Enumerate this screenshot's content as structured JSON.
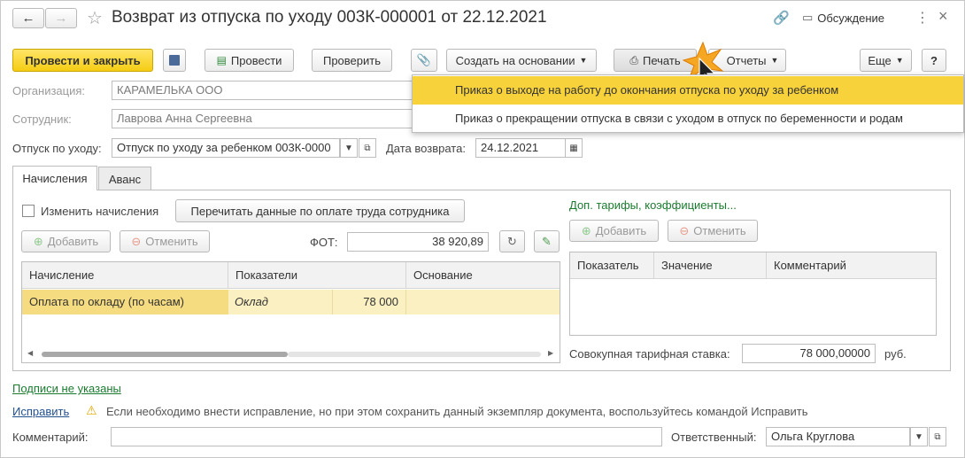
{
  "window": {
    "title": "Возврат из отпуска по уходу 003К-000001 от 22.12.2021",
    "discussion_label": "Обсуждение"
  },
  "toolbar": {
    "post_close": "Провести и закрыть",
    "post": "Провести",
    "check": "Проверить",
    "create_based": "Создать на основании",
    "print": "Печать",
    "reports": "Отчеты",
    "more": "Еще",
    "help": "?"
  },
  "print_menu": {
    "items": [
      "Приказ о выходе на работу до окончания отпуска по уходу за ребенком",
      "Приказ о прекращении отпуска в связи с уходом в отпуск по беременности и родам"
    ]
  },
  "form": {
    "org_label": "Организация:",
    "org_value": "КАРАМЕЛЬКА ООО",
    "emp_label": "Сотрудник:",
    "emp_value": "Лаврова Анна Сергеевна",
    "leave_label": "Отпуск по уходу:",
    "leave_value": "Отпуск по уходу за ребенком 003К-0000",
    "return_label": "Дата возврата:",
    "return_value": "24.12.2021"
  },
  "tabs": [
    "Начисления",
    "Аванс"
  ],
  "accruals": {
    "change_label": "Изменить начисления",
    "reread_button": "Перечитать данные по оплате труда сотрудника",
    "add": "Добавить",
    "cancel": "Отменить",
    "fot_label": "ФОТ:",
    "fot_value": "38 920,89",
    "columns": [
      "Начисление",
      "Показатели",
      "Основание"
    ],
    "rows": [
      {
        "accrual": "Оплата по окладу (по часам)",
        "indicator": "Оклад",
        "amount": "78 000",
        "basis": ""
      }
    ]
  },
  "tariffs": {
    "link": "Доп. тарифы, коэффициенты...",
    "add": "Добавить",
    "cancel": "Отменить",
    "columns": [
      "Показатель",
      "Значение",
      "Комментарий"
    ],
    "rate_label": "Совокупная тарифная ставка:",
    "rate_value": "78 000,00000",
    "currency": "руб."
  },
  "footer": {
    "signatures_link": "Подписи не указаны",
    "fix_link": "Исправить",
    "warning": "Если необходимо внести исправление, но при этом сохранить данный экземпляр документа, воспользуйтесь командой Исправить",
    "comment_label": "Комментарий:",
    "responsible_label": "Ответственный:",
    "responsible_value": "Ольга Круглова"
  },
  "colors": {
    "accent": "#f5cd14",
    "link_green": "#1a7b2f",
    "link_blue": "#23508f",
    "menu_selected": "#f7d23a"
  }
}
